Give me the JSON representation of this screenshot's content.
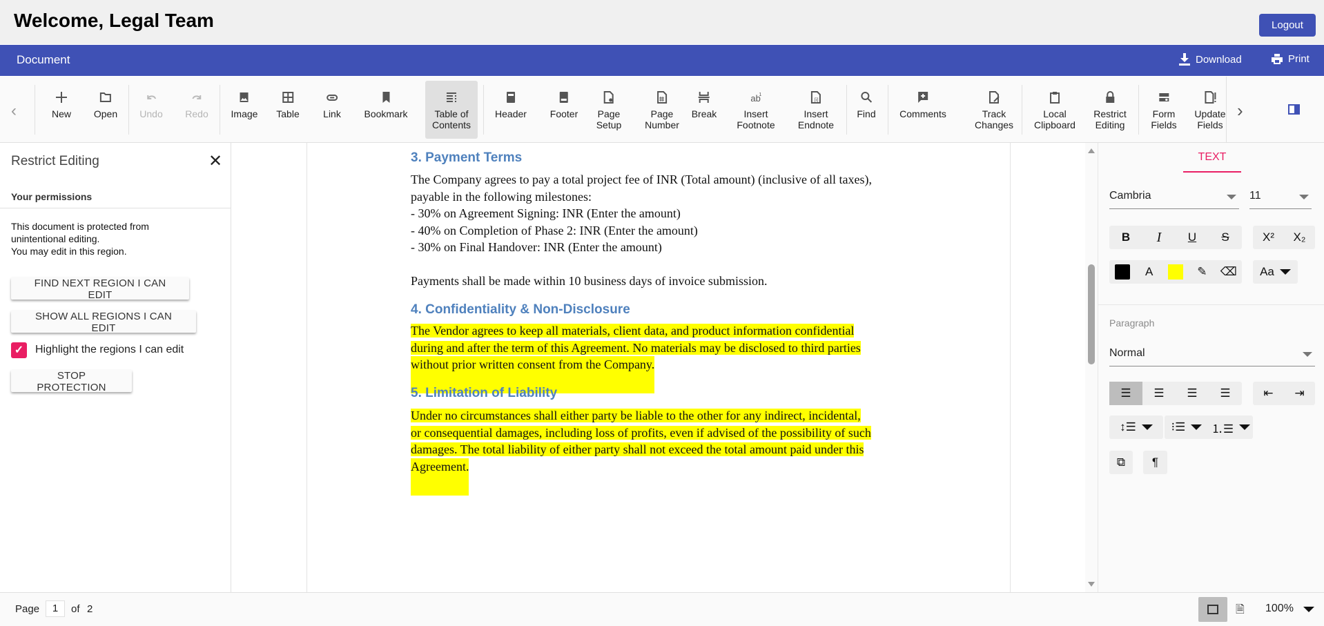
{
  "header": {
    "welcome": "Welcome, Legal Team",
    "logout_label": "Logout"
  },
  "titlebar": {
    "title": "Document",
    "download_label": "Download",
    "print_label": "Print"
  },
  "toolbar": {
    "items": [
      {
        "label": "New",
        "icon": "plus-icon"
      },
      {
        "label": "Open",
        "icon": "folder-icon"
      },
      {
        "label": "Undo",
        "icon": "undo-icon",
        "disabled": true
      },
      {
        "label": "Redo",
        "icon": "redo-icon",
        "disabled": true
      },
      {
        "label": "Image",
        "icon": "image-icon"
      },
      {
        "label": "Table",
        "icon": "table-icon"
      },
      {
        "label": "Link",
        "icon": "link-icon"
      },
      {
        "label": "Bookmark",
        "icon": "bookmark-icon"
      },
      {
        "label": "Table of\nContents",
        "icon": "toc-icon",
        "active": true
      },
      {
        "label": "Header",
        "icon": "header-icon"
      },
      {
        "label": "Footer",
        "icon": "footer-icon"
      },
      {
        "label": "Page\nSetup",
        "icon": "page-setup-icon"
      },
      {
        "label": "Page\nNumber",
        "icon": "page-number-icon"
      },
      {
        "label": "Break",
        "icon": "break-icon"
      },
      {
        "label": "Insert\nFootnote",
        "icon": "footnote-icon"
      },
      {
        "label": "Insert\nEndnote",
        "icon": "endnote-icon"
      },
      {
        "label": "Find",
        "icon": "search-icon"
      },
      {
        "label": "Comments",
        "icon": "comment-icon"
      },
      {
        "label": "Track\nChanges",
        "icon": "track-changes-icon"
      },
      {
        "label": "Local\nClipboard",
        "icon": "clipboard-icon"
      },
      {
        "label": "Restrict\nEditing",
        "icon": "lock-icon"
      },
      {
        "label": "Form\nFields",
        "icon": "form-fields-icon"
      },
      {
        "label": "Update\nFields",
        "icon": "update-fields-icon"
      }
    ]
  },
  "restrict_panel": {
    "title": "Restrict Editing",
    "permissions_heading": "Your permissions",
    "message_lines": [
      "This document is protected from",
      "unintentional editing.",
      "You may edit in this region."
    ],
    "find_next_label": "FIND NEXT REGION I CAN EDIT",
    "show_all_label": "SHOW ALL REGIONS I CAN EDIT",
    "highlight_label": "Highlight the regions I can edit",
    "highlight_checked": true,
    "stop_label": "STOP PROTECTION"
  },
  "document": {
    "sections": [
      {
        "heading": "3. Payment Terms",
        "highlighted": false,
        "lines": [
          "The Company agrees to pay a total project fee of INR (Total amount) (inclusive of all taxes),",
          "payable in the following milestones:",
          "- 30% on Agreement Signing: INR (Enter the amount)",
          "- 40% on Completion of Phase 2: INR (Enter the amount)",
          "- 30% on Final Handover: INR (Enter the amount)",
          "",
          "Payments shall be made within 10 business days of invoice submission."
        ]
      },
      {
        "heading": "4. Confidentiality & Non-Disclosure",
        "highlighted": true,
        "lines": [
          "The Vendor agrees to keep all materials, client data, and product information confidential",
          "during and after the term of this Agreement. No materials may be disclosed to third parties",
          "without prior written consent from the Company."
        ]
      },
      {
        "heading": "5. Limitation of Liability",
        "highlighted": true,
        "lines": [
          "Under no circumstances shall either party be liable to the other for any indirect, incidental,",
          "or consequential damages, including loss of profits, even if advised of the possibility of such",
          "damages. The total liability of either party shall not exceed the total amount paid under this",
          "Agreement."
        ]
      }
    ]
  },
  "properties": {
    "tab_label": "TEXT",
    "font_family": "Cambria",
    "font_size": "11",
    "paragraph_label": "Paragraph",
    "style": "Normal",
    "font_color": "#000000",
    "highlight_color": "#ffff00",
    "superscript": "X²",
    "subscript": "X₂",
    "change_case": "Aa"
  },
  "status": {
    "page_label": "Page",
    "current_page": "1",
    "of_label": "of",
    "total_pages": "2",
    "zoom": "100%"
  },
  "colors": {
    "accent": "#3f51b5",
    "tab_accent": "#e91e63",
    "heading": "#4f81bd",
    "highlight": "#ffff00"
  }
}
